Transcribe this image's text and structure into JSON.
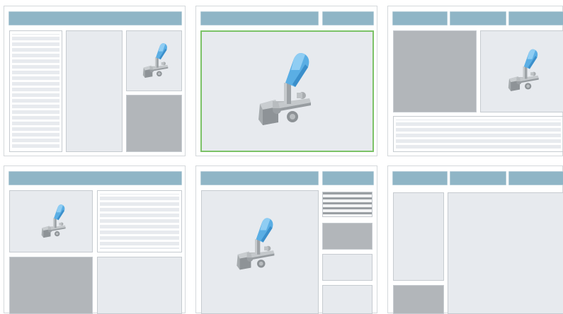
{
  "colors": {
    "header_bar": "#8fb5c6",
    "panel": "#e7eaee",
    "gray_panel": "#b2b6ba",
    "selected_border": "#7cc268",
    "arm_blue": "#5aaee4"
  },
  "layouts": [
    {
      "id": "layout-1",
      "selected": false,
      "icon": "robot-arm-icon"
    },
    {
      "id": "layout-2",
      "selected": true,
      "icon": "robot-arm-icon"
    },
    {
      "id": "layout-3",
      "selected": false,
      "icon": "robot-arm-icon"
    },
    {
      "id": "layout-4",
      "selected": false,
      "icon": "robot-arm-icon"
    },
    {
      "id": "layout-5",
      "selected": false,
      "icon": "robot-arm-icon"
    },
    {
      "id": "layout-6",
      "selected": false,
      "icon": "robot-arm-icon"
    }
  ]
}
